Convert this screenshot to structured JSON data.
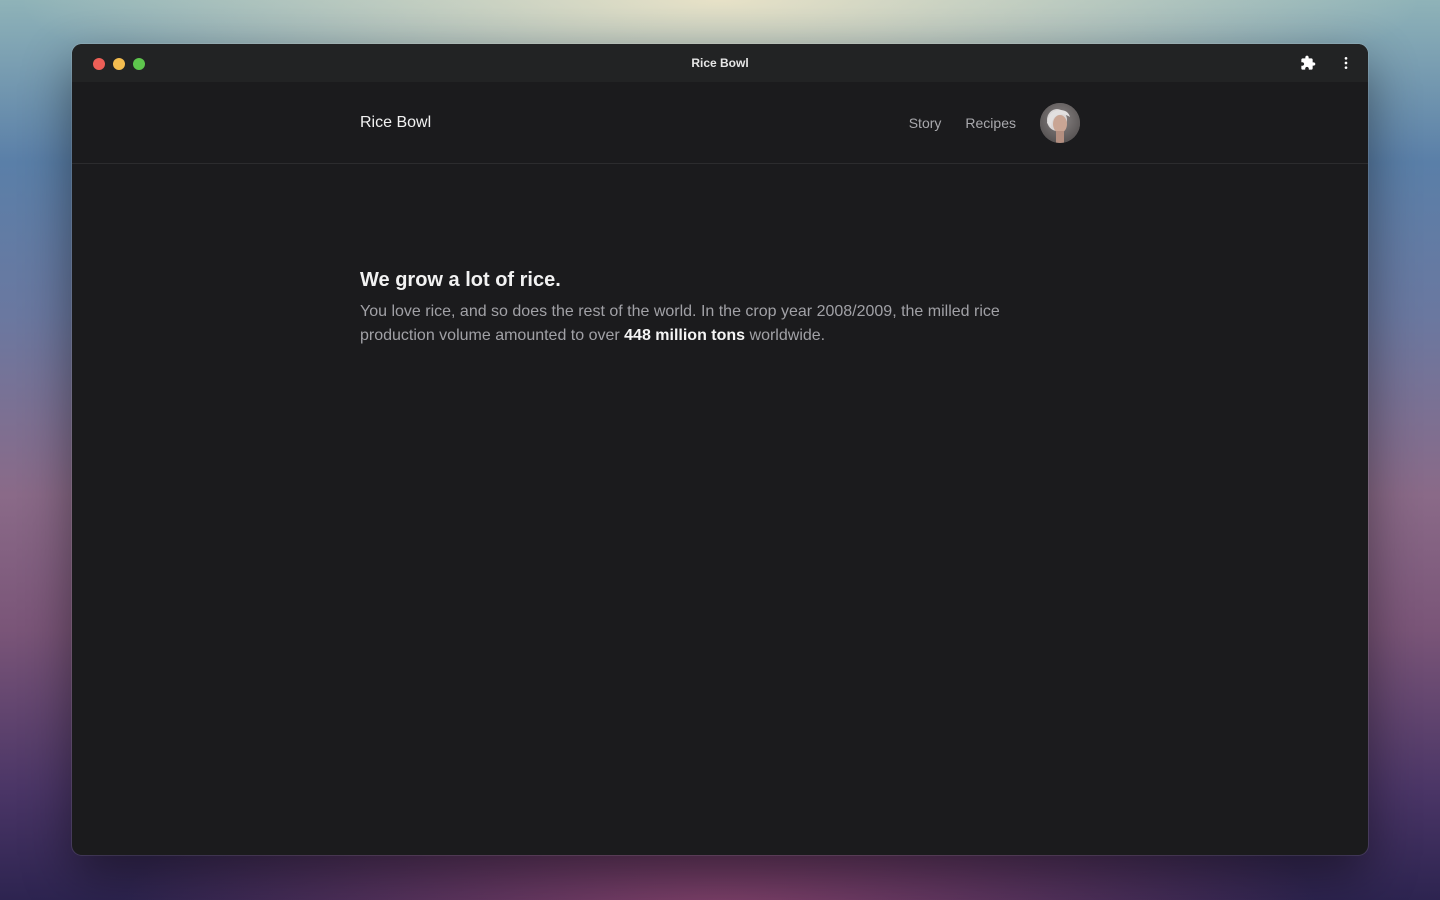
{
  "window": {
    "title": "Rice Bowl"
  },
  "toolbar": {
    "extensions_icon": "puzzle-icon",
    "menu_icon": "more-vertical-icon"
  },
  "nav": {
    "brand": "Rice Bowl",
    "links": [
      "Story",
      "Recipes"
    ],
    "avatar": "user-avatar"
  },
  "hero": {
    "headline": "We grow a lot of rice.",
    "paragraph_part1": "You love rice, and so does the rest of the world. In the crop year 2008/2009, the milled rice production volume amounted to over ",
    "paragraph_highlight": "448 million tons",
    "paragraph_part2": " worldwide."
  },
  "colors": {
    "window_bg": "#1b1b1d",
    "titlebar_bg": "#222324",
    "close": "#ed5f57",
    "minimize": "#f4bd4f",
    "maximize": "#5ec54d",
    "text_primary": "#f2f2f2",
    "text_muted": "#a1a1a6"
  }
}
